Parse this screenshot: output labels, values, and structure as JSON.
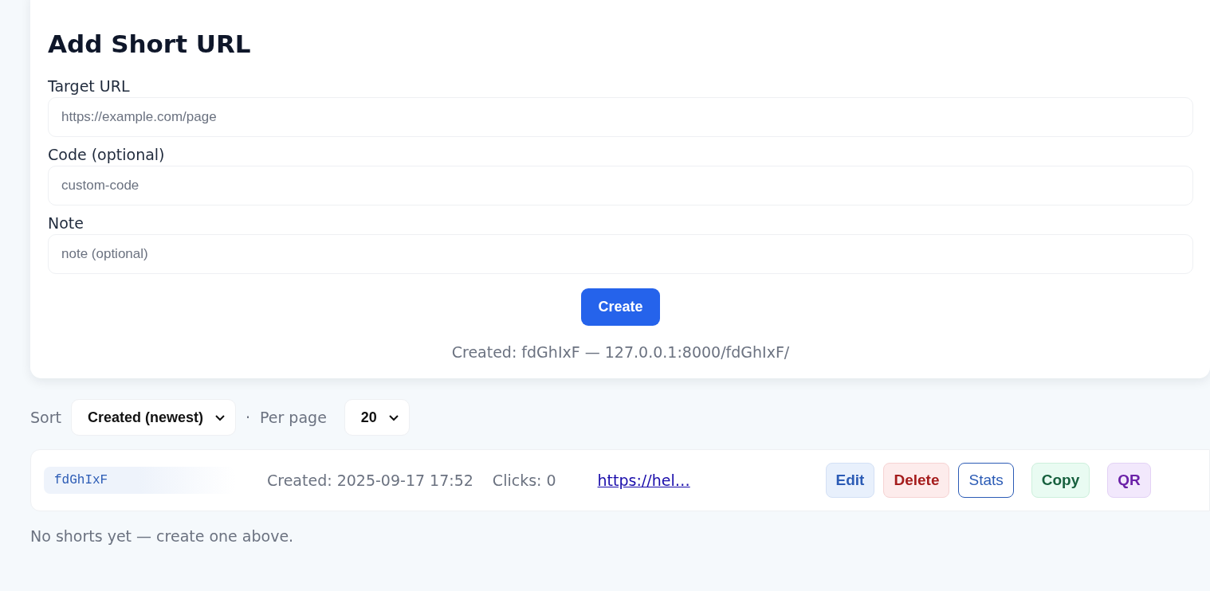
{
  "form": {
    "title": "Add Short URL",
    "fields": [
      {
        "label": "Target URL",
        "placeholder": "https://example.com/page"
      },
      {
        "label": "Code (optional)",
        "placeholder": "custom-code"
      },
      {
        "label": "Note",
        "placeholder": "note (optional)"
      }
    ],
    "submit": "Create",
    "result": "Created: fdGhIxF — 127.0.0.1:8000/fdGhIxF/"
  },
  "controls": {
    "sort_label": "Sort",
    "sort_value": "Created (newest)",
    "separator": "·",
    "per_page_label": "Per page",
    "per_page_value": "20"
  },
  "shorts": [
    {
      "code": "fdGhIxF",
      "created": "Created: 2025-09-17 17:52",
      "clicks": "Clicks: 0",
      "target": "https://hel…",
      "actions": [
        {
          "kind": "edit",
          "label": "Edit"
        },
        {
          "kind": "delete",
          "label": "Delete"
        },
        {
          "kind": "stats",
          "label": "Stats"
        },
        {
          "kind": "copy",
          "label": "Copy"
        },
        {
          "kind": "qr",
          "label": "QR"
        }
      ]
    }
  ],
  "empty_message": "No shorts yet — create one above."
}
